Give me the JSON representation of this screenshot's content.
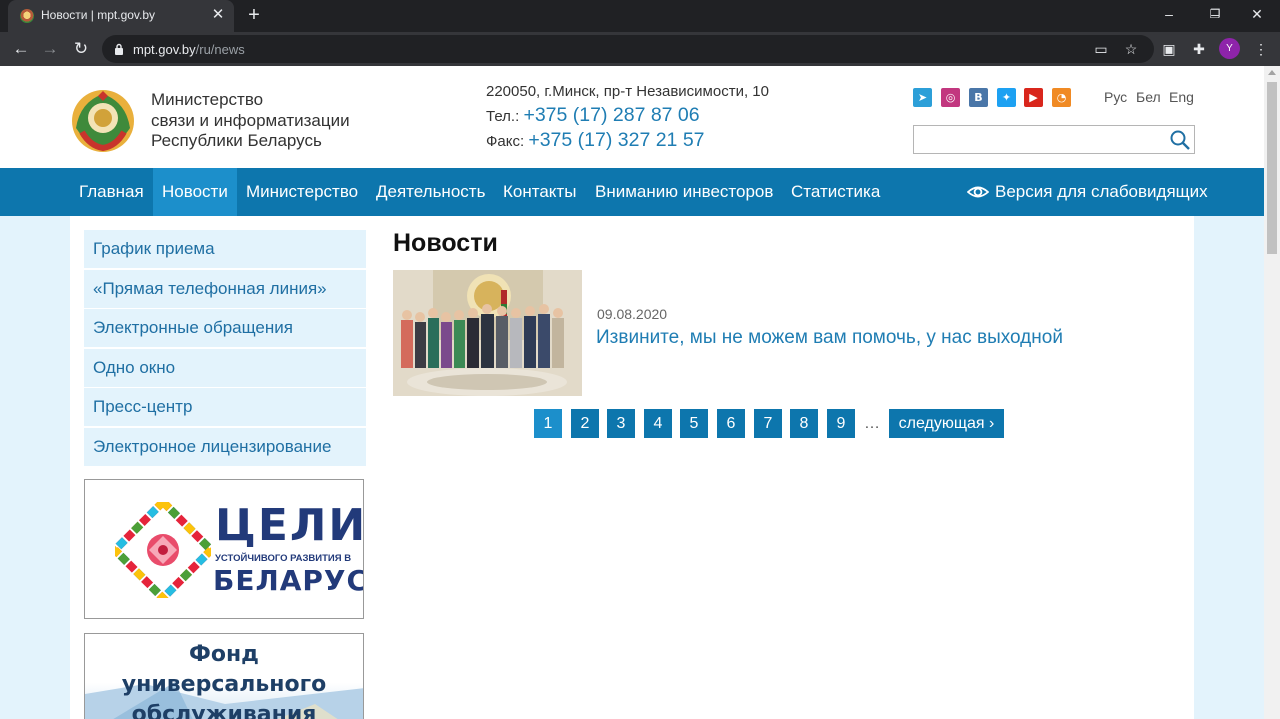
{
  "browser": {
    "tab_title": "Новости | mpt.gov.by",
    "new_tab": "+",
    "close_tab": "✕",
    "url_host": "mpt.gov.by",
    "url_path": "/ru/news",
    "avatar_letter": "Y",
    "window_controls": [
      "–",
      "❐",
      "✕"
    ]
  },
  "header": {
    "ministry_lines": [
      "Министерство",
      "связи и информатизации",
      "Республики Беларусь"
    ],
    "address": "220050, г.Минск, пр-т Независимости, 10",
    "phone_label": "Тел.:",
    "phone": "+375 (17) 287 87 06",
    "fax_label": "Факс:",
    "fax": "+375 (17) 327 21 57",
    "social_icons": [
      "telegram-icon",
      "instagram-icon",
      "vk-icon",
      "twitter-icon",
      "youtube-icon",
      "rss-icon"
    ],
    "social_colors": [
      "#2c9fd8",
      "#c2377f",
      "#4a76a8",
      "#1da1f2",
      "#d9261c",
      "#f08a24"
    ],
    "lang_current": "Рус",
    "lang_be": "Бел",
    "lang_en": "Eng",
    "search_placeholder": ""
  },
  "nav": {
    "items": [
      "Главная",
      "Новости",
      "Министерство",
      "Деятельность",
      "Контакты",
      "Вниманию инвесторов",
      "Статистика"
    ],
    "active": "Новости",
    "low_vision": "Версия для слабовидящих"
  },
  "sidebar": {
    "items": [
      "График приема",
      "«Прямая телефонная линия»",
      "Электронные обращения",
      "Одно окно",
      "Пресс-центр",
      "Электронное лицензирование"
    ]
  },
  "banners": {
    "goals_title": "ЦЕЛИ",
    "goals_subtitle": "УСТОЙЧИВОГО РАЗВИТИЯ В",
    "goals_country": "БЕЛАРУСИ",
    "fund_line1": "Фонд универсального",
    "fund_line2": "обслуживания"
  },
  "main": {
    "title": "Новости",
    "news": [
      {
        "date": "09.08.2020",
        "title": "Извините, мы не можем вам помочь, у нас выходной"
      }
    ],
    "pager": {
      "pages": [
        "1",
        "2",
        "3",
        "4",
        "5",
        "6",
        "7",
        "8",
        "9"
      ],
      "current": "1",
      "ellipsis": "…",
      "next": "следующая ›"
    }
  },
  "colors": {
    "nav_bg": "#0d76ad",
    "nav_active": "#1c8fcb",
    "link": "#1f7db3",
    "page_bg": "#e3f3fc"
  }
}
